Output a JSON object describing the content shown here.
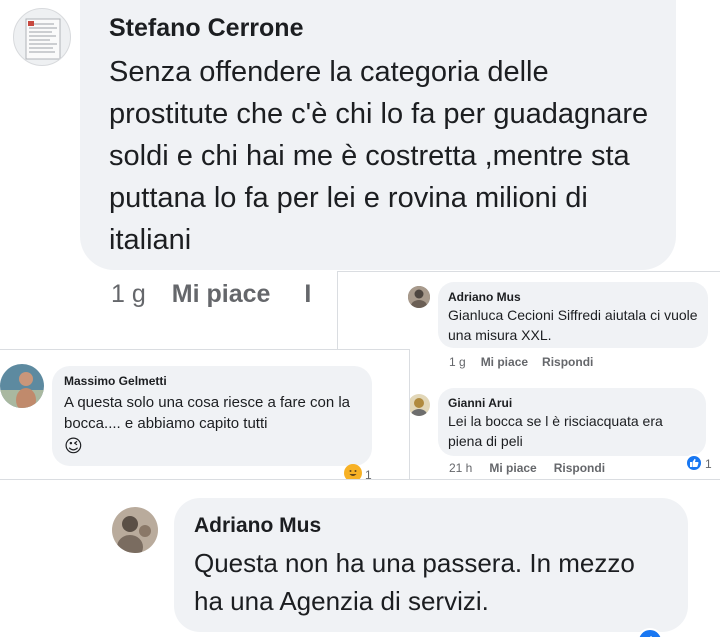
{
  "main_comment": {
    "author": "Stefano Cerrone",
    "text": "Senza offendere la categoria delle prostitute che c'è chi lo fa per guadagnare soldi e chi hai me è costretta  ,mentre sta puttana lo fa per lei e rovina milioni di italiani",
    "time": "1 g",
    "like_label": "Mi piace",
    "reply_label_partial": "I"
  },
  "snippet_adriano_1": {
    "author": "Adriano Mus",
    "text": "Gianluca Cecioni  Siffredi aiutala ci vuole una misura XXL.",
    "time": "1 g",
    "like_label": "Mi piace",
    "reply_label": "Rispondi"
  },
  "snippet_gianni": {
    "author": "Gianni Arui",
    "text": "Lei la bocca se l è risciacquata era piena di peli",
    "time": "21 h",
    "like_label": "Mi piace",
    "reply_label": "Rispondi",
    "reaction_count": "1",
    "reaction_icon": "like-icon",
    "reaction_color": "#1877f2"
  },
  "snippet_massimo": {
    "author": "Massimo Gelmetti",
    "text": "A questa solo una cosa riesce a fare con la bocca.... e abbiamo capito tutti",
    "emoji": "😉",
    "reaction_count": "1"
  },
  "snippet_adriano_2": {
    "author": "Adriano Mus",
    "text": "Questa non ha una passera. In mezzo  ha una Agenzia di servizi."
  }
}
